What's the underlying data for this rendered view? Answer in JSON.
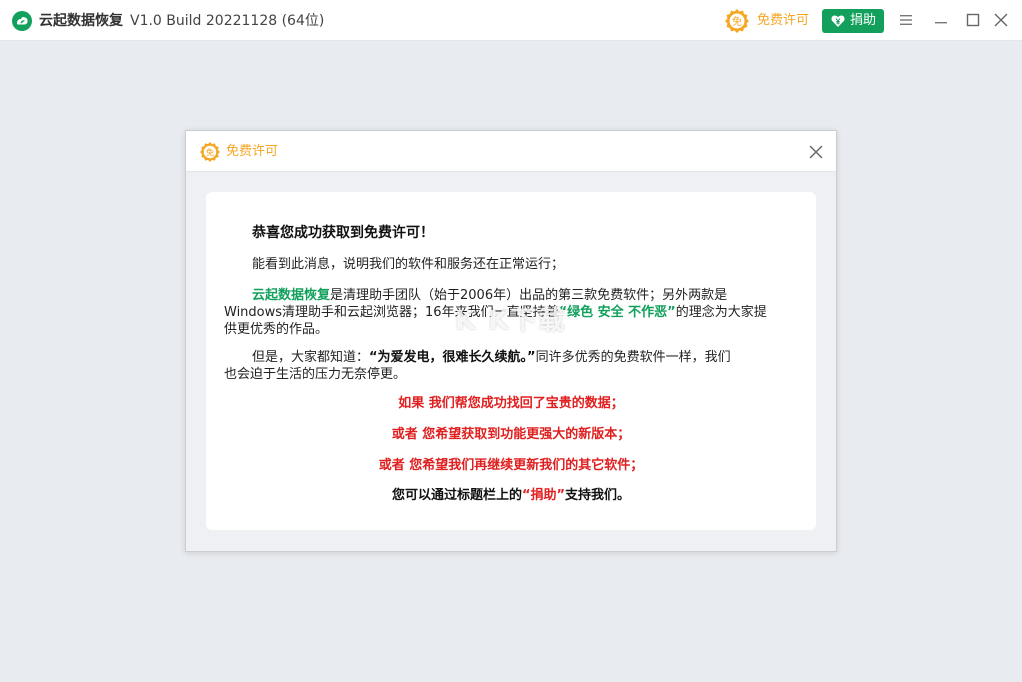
{
  "titlebar": {
    "app_name": "云起数据恢复",
    "version": "V1.0 Build 20221128 (64位)",
    "free_license_label": "免费许可",
    "free_badge_char": "免",
    "donate_label": "捐助"
  },
  "dialog": {
    "title": "免费许可",
    "badge_char": "免",
    "greeting": "恭喜您成功获取到免费许可！",
    "msg1": "能看到此消息，说明我们的软件和服务还在正常运行；",
    "para2": {
      "product": "云起数据恢复",
      "text_a": "是清理助手团队（始于2006年）出品的第三款免费软件；另外两款是",
      "text_b1": "Windows清理助手和云起浏览器；16年来我们一直坚持着",
      "motto": "“绿色 安全 不作恶”",
      "text_b2": "的理念为大家提",
      "text_c": "供更优秀的作品。"
    },
    "para3": {
      "text_a1": "但是，大家都知道：",
      "quote": "“为爱发电，很难长久续航。”",
      "text_a2": "同许多优秀的免费软件一样，我们",
      "text_b": "也会迫于生活的压力无奈停更。"
    },
    "red_lines": [
      "如果 我们帮您成功找回了宝贵的数据；",
      "或者 您希望获取到功能更强大的新版本；",
      "或者 您希望我们再继续更新我们的其它软件；"
    ],
    "final": {
      "text_a": "您可以通过标题栏上的",
      "highlight": "“捐助”",
      "text_b": "支持我们。"
    }
  },
  "watermark": "K K下载",
  "colors": {
    "accent_green": "#12a05c",
    "accent_orange": "#f5a623",
    "alert_red": "#e02020",
    "background": "#e8ebef"
  },
  "icons": {
    "app_logo": "cloud-leaf-logo-icon",
    "free_badge": "badge-icon",
    "donate": "heart-yen-icon",
    "menu": "hamburger-menu-icon",
    "minimize": "minimize-icon",
    "maximize": "maximize-icon",
    "close": "close-icon"
  }
}
